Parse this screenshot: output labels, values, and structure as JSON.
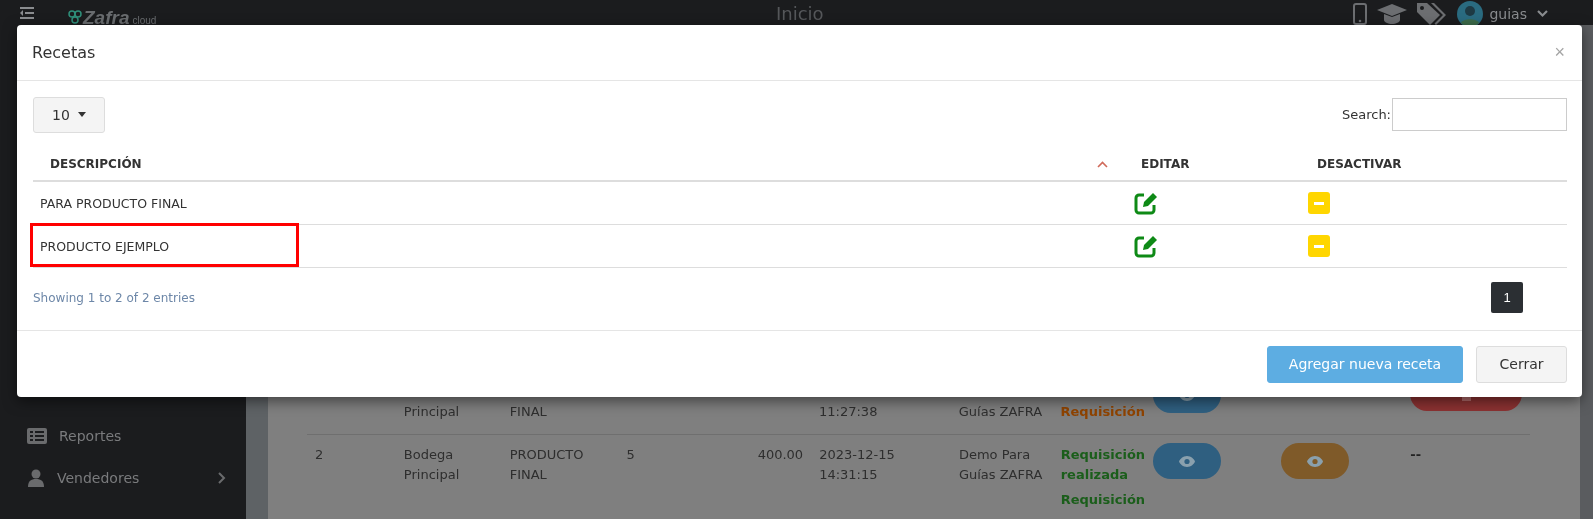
{
  "topbar": {
    "logo": {
      "name": "Zafra",
      "suffix": "cloud"
    },
    "title": "Inicio",
    "user": "guias"
  },
  "sidebar": {
    "items": [
      {
        "label": "Reportes",
        "expandable": false
      },
      {
        "label": "Vendedores",
        "expandable": true
      }
    ]
  },
  "background_table": {
    "rows": [
      {
        "cells": [
          "",
          "Principal",
          "FINAL",
          "",
          "",
          "11:27:38",
          "Guías ZAFRA"
        ],
        "statuses": [
          {
            "text": "Requisición",
            "color": "#8f4300"
          }
        ],
        "view_buttons": [
          {
            "color": "#2f5f80"
          }
        ],
        "last": {
          "kind": "button"
        }
      },
      {
        "cells": [
          "2",
          "Bodega Principal",
          "PRODUCTO FINAL",
          "5",
          "400.00",
          "2023-12-15 14:31:15",
          "Demo Para Guías ZAFRA"
        ],
        "statuses": [
          {
            "text": "Requisición realizada",
            "color": "#1b5e1b"
          },
          {
            "text": "Requisición",
            "color": "#1b5e1b"
          }
        ],
        "view_buttons": [
          {
            "color": "#2f5f80"
          },
          {
            "color": "#7f5a29"
          }
        ],
        "last": {
          "kind": "text",
          "text": "--"
        }
      }
    ]
  },
  "modal": {
    "title": "Recetas",
    "close": "×",
    "page_length": "10",
    "search": {
      "label": "Search:"
    },
    "columns": [
      {
        "label": "DESCRIPCIÓN",
        "sorted": true
      },
      {
        "label": "EDITAR",
        "sorted": false
      },
      {
        "label": "DESACTIVAR",
        "sorted": false
      }
    ],
    "rows": [
      {
        "description": "PARA PRODUCTO FINAL",
        "highlighted": false
      },
      {
        "description": "PRODUCTO EJEMPLO",
        "highlighted": true
      }
    ],
    "info": "Showing 1 to 2 of 2 entries",
    "pages": [
      {
        "label": "1",
        "selected": true
      }
    ],
    "buttons": [
      {
        "label": "Agregar nueva receta",
        "kind": "primary"
      },
      {
        "label": "Cerrar",
        "kind": "default"
      }
    ]
  }
}
